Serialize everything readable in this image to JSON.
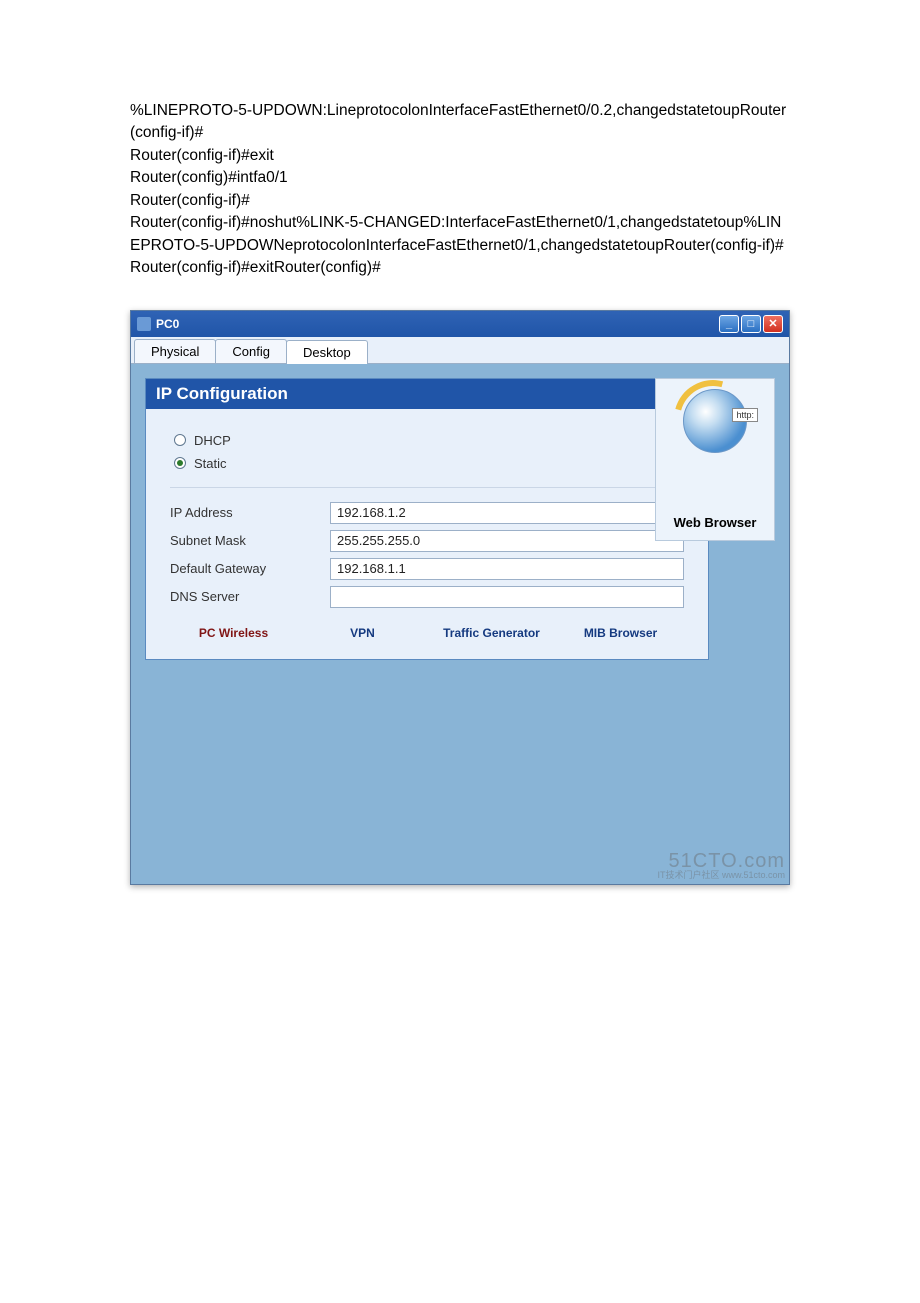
{
  "cli": {
    "lines": [
      "%LINEPROTO-5-UPDOWN:LineprotocolonInterfaceFastEthernet0/0.2,changedstatetoupRouter(config-if)#",
      "Router(config-if)#exit",
      "Router(config)#intfa0/1",
      "Router(config-if)#",
      "Router(config-if)#noshut%LINK-5-CHANGED:InterfaceFastEthernet0/1,changedstatetoup%LINEPROTO-5-UPDOWNeprotocolonInterfaceFastEthernet0/1,changedstatetoupRouter(config-if)#Router(config-if)#exitRouter(config)#"
    ]
  },
  "window": {
    "title": "PC0",
    "tabs": [
      "Physical",
      "Config",
      "Desktop"
    ],
    "activeTab": 2
  },
  "panel": {
    "title": "IP Configuration",
    "mode": {
      "dhcp": "DHCP",
      "static": "Static",
      "selected": "static"
    },
    "fields": {
      "ipLabel": "IP Address",
      "ip": "192.168.1.2",
      "maskLabel": "Subnet Mask",
      "mask": "255.255.255.0",
      "gwLabel": "Default Gateway",
      "gw": "192.168.1.1",
      "dnsLabel": "DNS Server",
      "dns": ""
    },
    "apps": {
      "wireless": "PC Wireless",
      "vpn": "VPN",
      "traffic": "Traffic Generator",
      "mib": "MIB Browser"
    }
  },
  "side": {
    "httpTag": "http:",
    "label": "Web Browser"
  },
  "watermark": {
    "main": "51CTO.com",
    "sub": "IT技术门户社区 www.51cto.com"
  }
}
